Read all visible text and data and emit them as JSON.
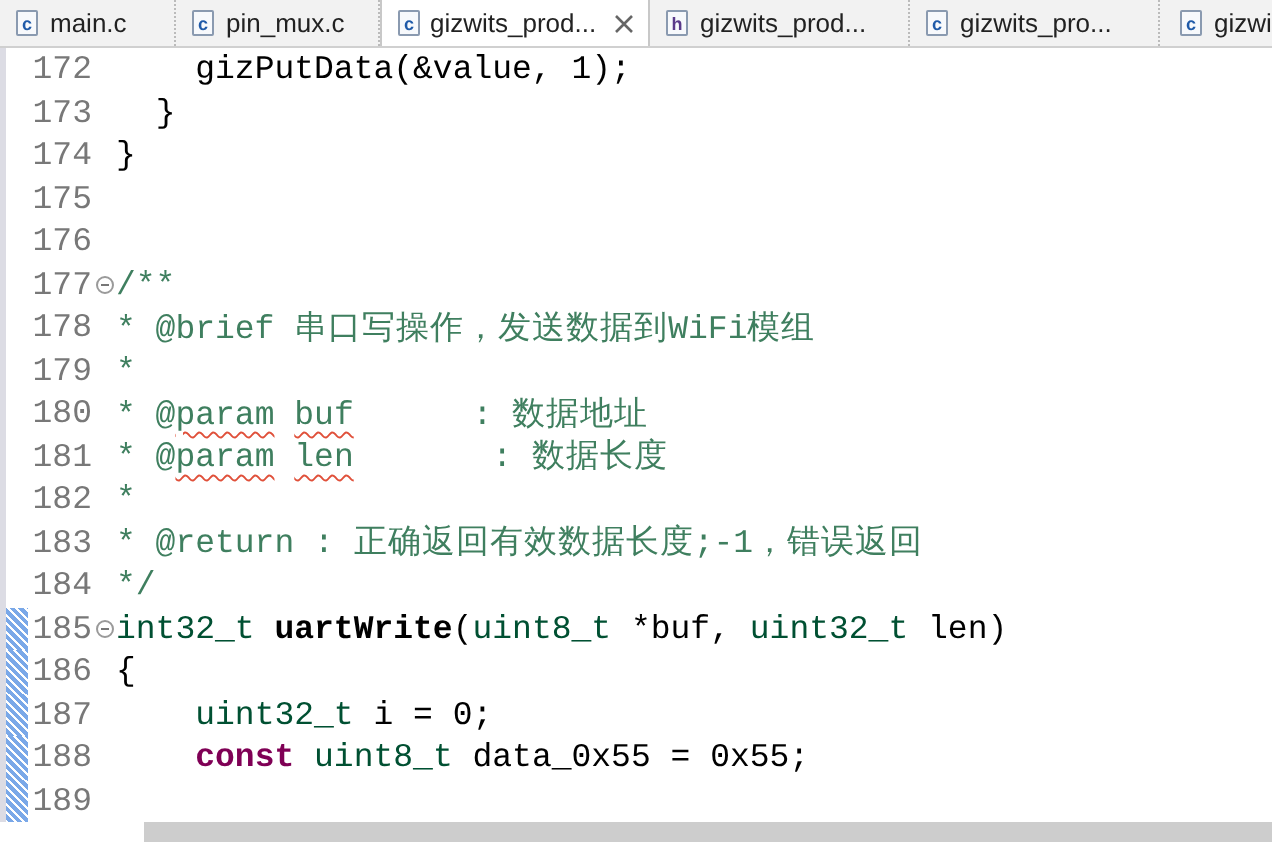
{
  "tabs": [
    {
      "file_type": "c",
      "label": "main.c",
      "selected": false,
      "closable": false
    },
    {
      "file_type": "c",
      "label": "pin_mux.c",
      "selected": false,
      "closable": false
    },
    {
      "file_type": "c",
      "label": "gizwits_prod...",
      "selected": true,
      "closable": true
    },
    {
      "file_type": "h",
      "label": "gizwits_prod...",
      "selected": false,
      "closable": false
    },
    {
      "file_type": "c",
      "label": "gizwits_pro...",
      "selected": false,
      "closable": false
    },
    {
      "file_type": "c",
      "label": "gizwi",
      "selected": false,
      "closable": false
    }
  ],
  "editor": {
    "lines": [
      {
        "number": "172",
        "fold": false,
        "changed": false,
        "tokens": [
          {
            "text": "    gizPutData(&value, 1);",
            "kind": "plain"
          }
        ]
      },
      {
        "number": "173",
        "fold": false,
        "changed": false,
        "tokens": [
          {
            "text": "  }",
            "kind": "plain"
          }
        ]
      },
      {
        "number": "174",
        "fold": false,
        "changed": false,
        "tokens": [
          {
            "text": "}",
            "kind": "plain"
          }
        ]
      },
      {
        "number": "175",
        "fold": false,
        "changed": false
      },
      {
        "number": "176",
        "fold": false,
        "changed": false
      },
      {
        "number": "177",
        "fold": true,
        "changed": false,
        "tokens": [
          {
            "text": "/**",
            "kind": "comment"
          }
        ]
      },
      {
        "number": "178",
        "fold": false,
        "changed": false,
        "tokens": [
          {
            "text": "* @brief 串口写操作，发送数据到WiFi模组",
            "kind": "comment"
          }
        ]
      },
      {
        "number": "179",
        "fold": false,
        "changed": false,
        "tokens": [
          {
            "text": "*",
            "kind": "comment"
          }
        ]
      },
      {
        "number": "180",
        "fold": false,
        "changed": false,
        "tokens": [
          {
            "text": "* @",
            "kind": "comment"
          },
          {
            "text": "param",
            "kind": "comment",
            "misspelled": true
          },
          {
            "text": " buf",
            "kind": "comment",
            "misspelled": true
          },
          {
            "text": "      : 数据地址",
            "kind": "comment"
          }
        ]
      },
      {
        "number": "181",
        "fold": false,
        "changed": false,
        "tokens": [
          {
            "text": "* @",
            "kind": "comment"
          },
          {
            "text": "param",
            "kind": "comment",
            "misspelled": true
          },
          {
            "text": " len",
            "kind": "comment",
            "misspelled": true
          },
          {
            "text": "       : 数据长度",
            "kind": "comment"
          }
        ]
      },
      {
        "number": "182",
        "fold": false,
        "changed": false,
        "tokens": [
          {
            "text": "*",
            "kind": "comment"
          }
        ]
      },
      {
        "number": "183",
        "fold": false,
        "changed": false,
        "tokens": [
          {
            "text": "* @return : 正确返回有效数据长度;-1，错误返回",
            "kind": "comment"
          }
        ]
      },
      {
        "number": "184",
        "fold": false,
        "changed": false,
        "tokens": [
          {
            "text": "*/",
            "kind": "comment"
          }
        ]
      },
      {
        "number": "185",
        "fold": true,
        "changed": true,
        "tokens": [
          {
            "text": "int32_t",
            "kind": "type"
          },
          {
            "text": " uartWrite",
            "kind": "function"
          },
          {
            "text": "(",
            "kind": "plain"
          },
          {
            "text": "uint8_t",
            "kind": "type"
          },
          {
            "text": " *buf, ",
            "kind": "plain"
          },
          {
            "text": "uint32_t",
            "kind": "type"
          },
          {
            "text": " len)",
            "kind": "plain"
          }
        ]
      },
      {
        "number": "186",
        "fold": false,
        "changed": true,
        "tokens": [
          {
            "text": "{",
            "kind": "plain"
          }
        ]
      },
      {
        "number": "187",
        "fold": false,
        "changed": true,
        "tokens": [
          {
            "text": "    uint32_t",
            "kind": "type"
          },
          {
            "text": " i = 0;",
            "kind": "plain"
          }
        ]
      },
      {
        "number": "188",
        "fold": false,
        "changed": true,
        "tokens": [
          {
            "text": "    const",
            "kind": "keyword"
          },
          {
            "text": " uint8_t",
            "kind": "type"
          },
          {
            "text": " data_0x55 = 0x55;",
            "kind": "plain"
          }
        ]
      },
      {
        "number": "189",
        "fold": false,
        "changed": true
      }
    ]
  }
}
